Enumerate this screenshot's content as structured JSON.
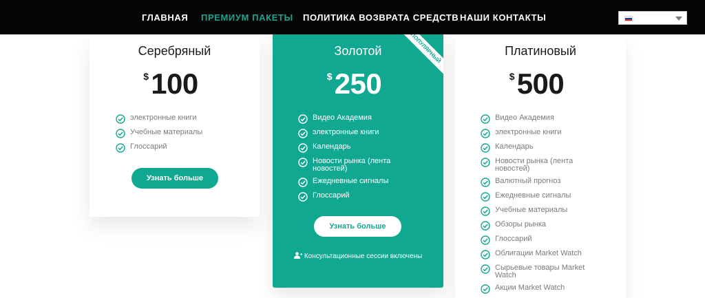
{
  "nav": {
    "items": [
      {
        "label": "ГЛАВНАЯ",
        "active": false
      },
      {
        "label": "ПРЕМИУМ ПАКЕТЫ",
        "active": true
      },
      {
        "label": "ПОЛИТИКА ВОЗВРАТА СРЕДСТВ",
        "active": false
      },
      {
        "label": "НАШИ КОНТАКТЫ",
        "active": false
      }
    ],
    "language": {
      "flag": "russian-flag-icon",
      "value": ""
    }
  },
  "colors": {
    "accent": "#11a892",
    "nav_background": "#050505",
    "nav_active": "#19a58f"
  },
  "plans": [
    {
      "title": "Серебряный",
      "currency": "$",
      "price": "100",
      "features": [
        "электронные книги",
        "Учебные материалы",
        "Глоссарий"
      ],
      "button": "Узнать больше"
    },
    {
      "title": "Золотой",
      "currency": "$",
      "price": "250",
      "ribbon": "ПОПУЛЯРНЫЙ",
      "features": [
        "Видео Академия",
        "электронные книги",
        "Календарь",
        "Новости рынка (лента новостей)",
        "Ежедневные сигналы",
        "Глоссарий"
      ],
      "button": "Узнать больше",
      "note": "Консультационные сессии включены"
    },
    {
      "title": "Платиновый",
      "currency": "$",
      "price": "500",
      "features": [
        "Видео Академия",
        "электронные книги",
        "Календарь",
        "Новости рынка (лента новостей)",
        "Валютный прогноз",
        "Ежедневные сигналы",
        "Учебные материалы",
        "Обзоры рынка",
        "Глоссарий",
        "Облигации Market Watch",
        "Сырьевые товары Market Watch",
        "Акции Market Watch"
      ]
    }
  ]
}
